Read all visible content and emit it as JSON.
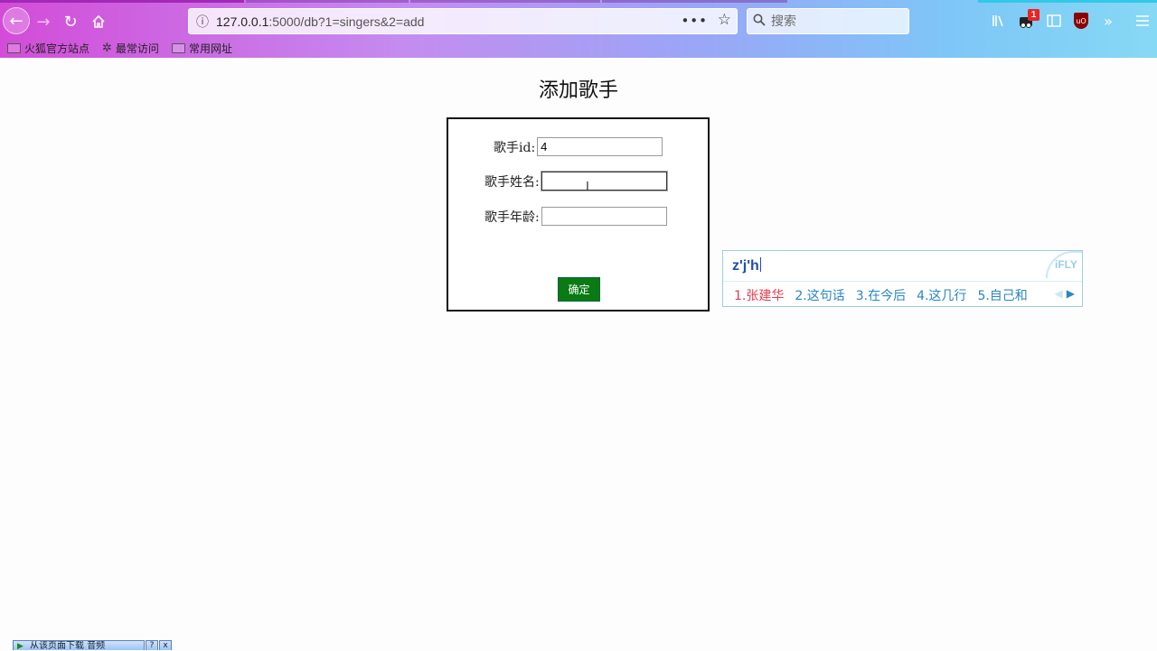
{
  "browser": {
    "url_host": "127.0.0.1",
    "url_rest": ":5000/db?1=singers&2=add",
    "more_label": "•••",
    "search_placeholder": "搜索",
    "notification_count": "1",
    "bookmarks": [
      {
        "label": "火狐官方站点"
      },
      {
        "label": "最常访问"
      },
      {
        "label": "常用网址"
      }
    ]
  },
  "page": {
    "title": "添加歌手",
    "fields": {
      "id_label": "歌手id:",
      "id_value": "4",
      "name_label": "歌手姓名:",
      "name_value": "",
      "age_label": "歌手年龄:",
      "age_value": ""
    },
    "submit_label": "确定"
  },
  "ime": {
    "composition": "z'j'h",
    "logo": "iFLY",
    "candidates": [
      "1.张建华",
      "2.这句话",
      "3.在今后",
      "4.这几行",
      "5.自己和"
    ],
    "next_arrow": "▶",
    "prev_arrow": "◀"
  },
  "bottom_widget": {
    "label": "从该页面下载 音频",
    "help": "?",
    "close": "x"
  }
}
